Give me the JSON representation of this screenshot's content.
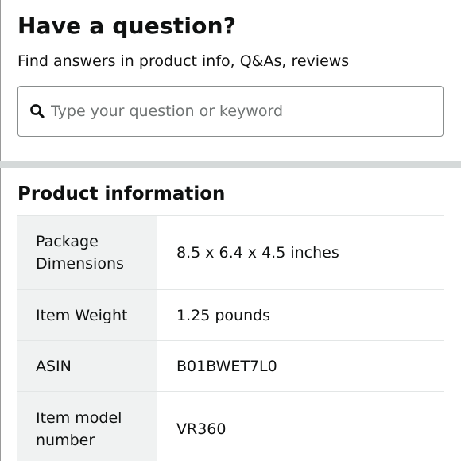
{
  "qa": {
    "title": "Have a question?",
    "subtitle": "Find answers in product info, Q&As, reviews",
    "search": {
      "icon": "search-icon",
      "placeholder": "Type your question or keyword",
      "value": ""
    }
  },
  "product_info": {
    "title": "Product information",
    "rows": [
      {
        "label": "Package Dimensions",
        "value": "8.5 x 6.4 x 4.5 inches"
      },
      {
        "label": "Item Weight",
        "value": "1.25 pounds"
      },
      {
        "label": "ASIN",
        "value": "B01BWET7L0"
      },
      {
        "label": "Item model number",
        "value": "VR360"
      }
    ]
  },
  "colors": {
    "label_cell_bg": "#f0f2f2",
    "divider_band": "#d5d9d9",
    "search_border": "#888c8c",
    "placeholder_text": "#6f7373"
  }
}
